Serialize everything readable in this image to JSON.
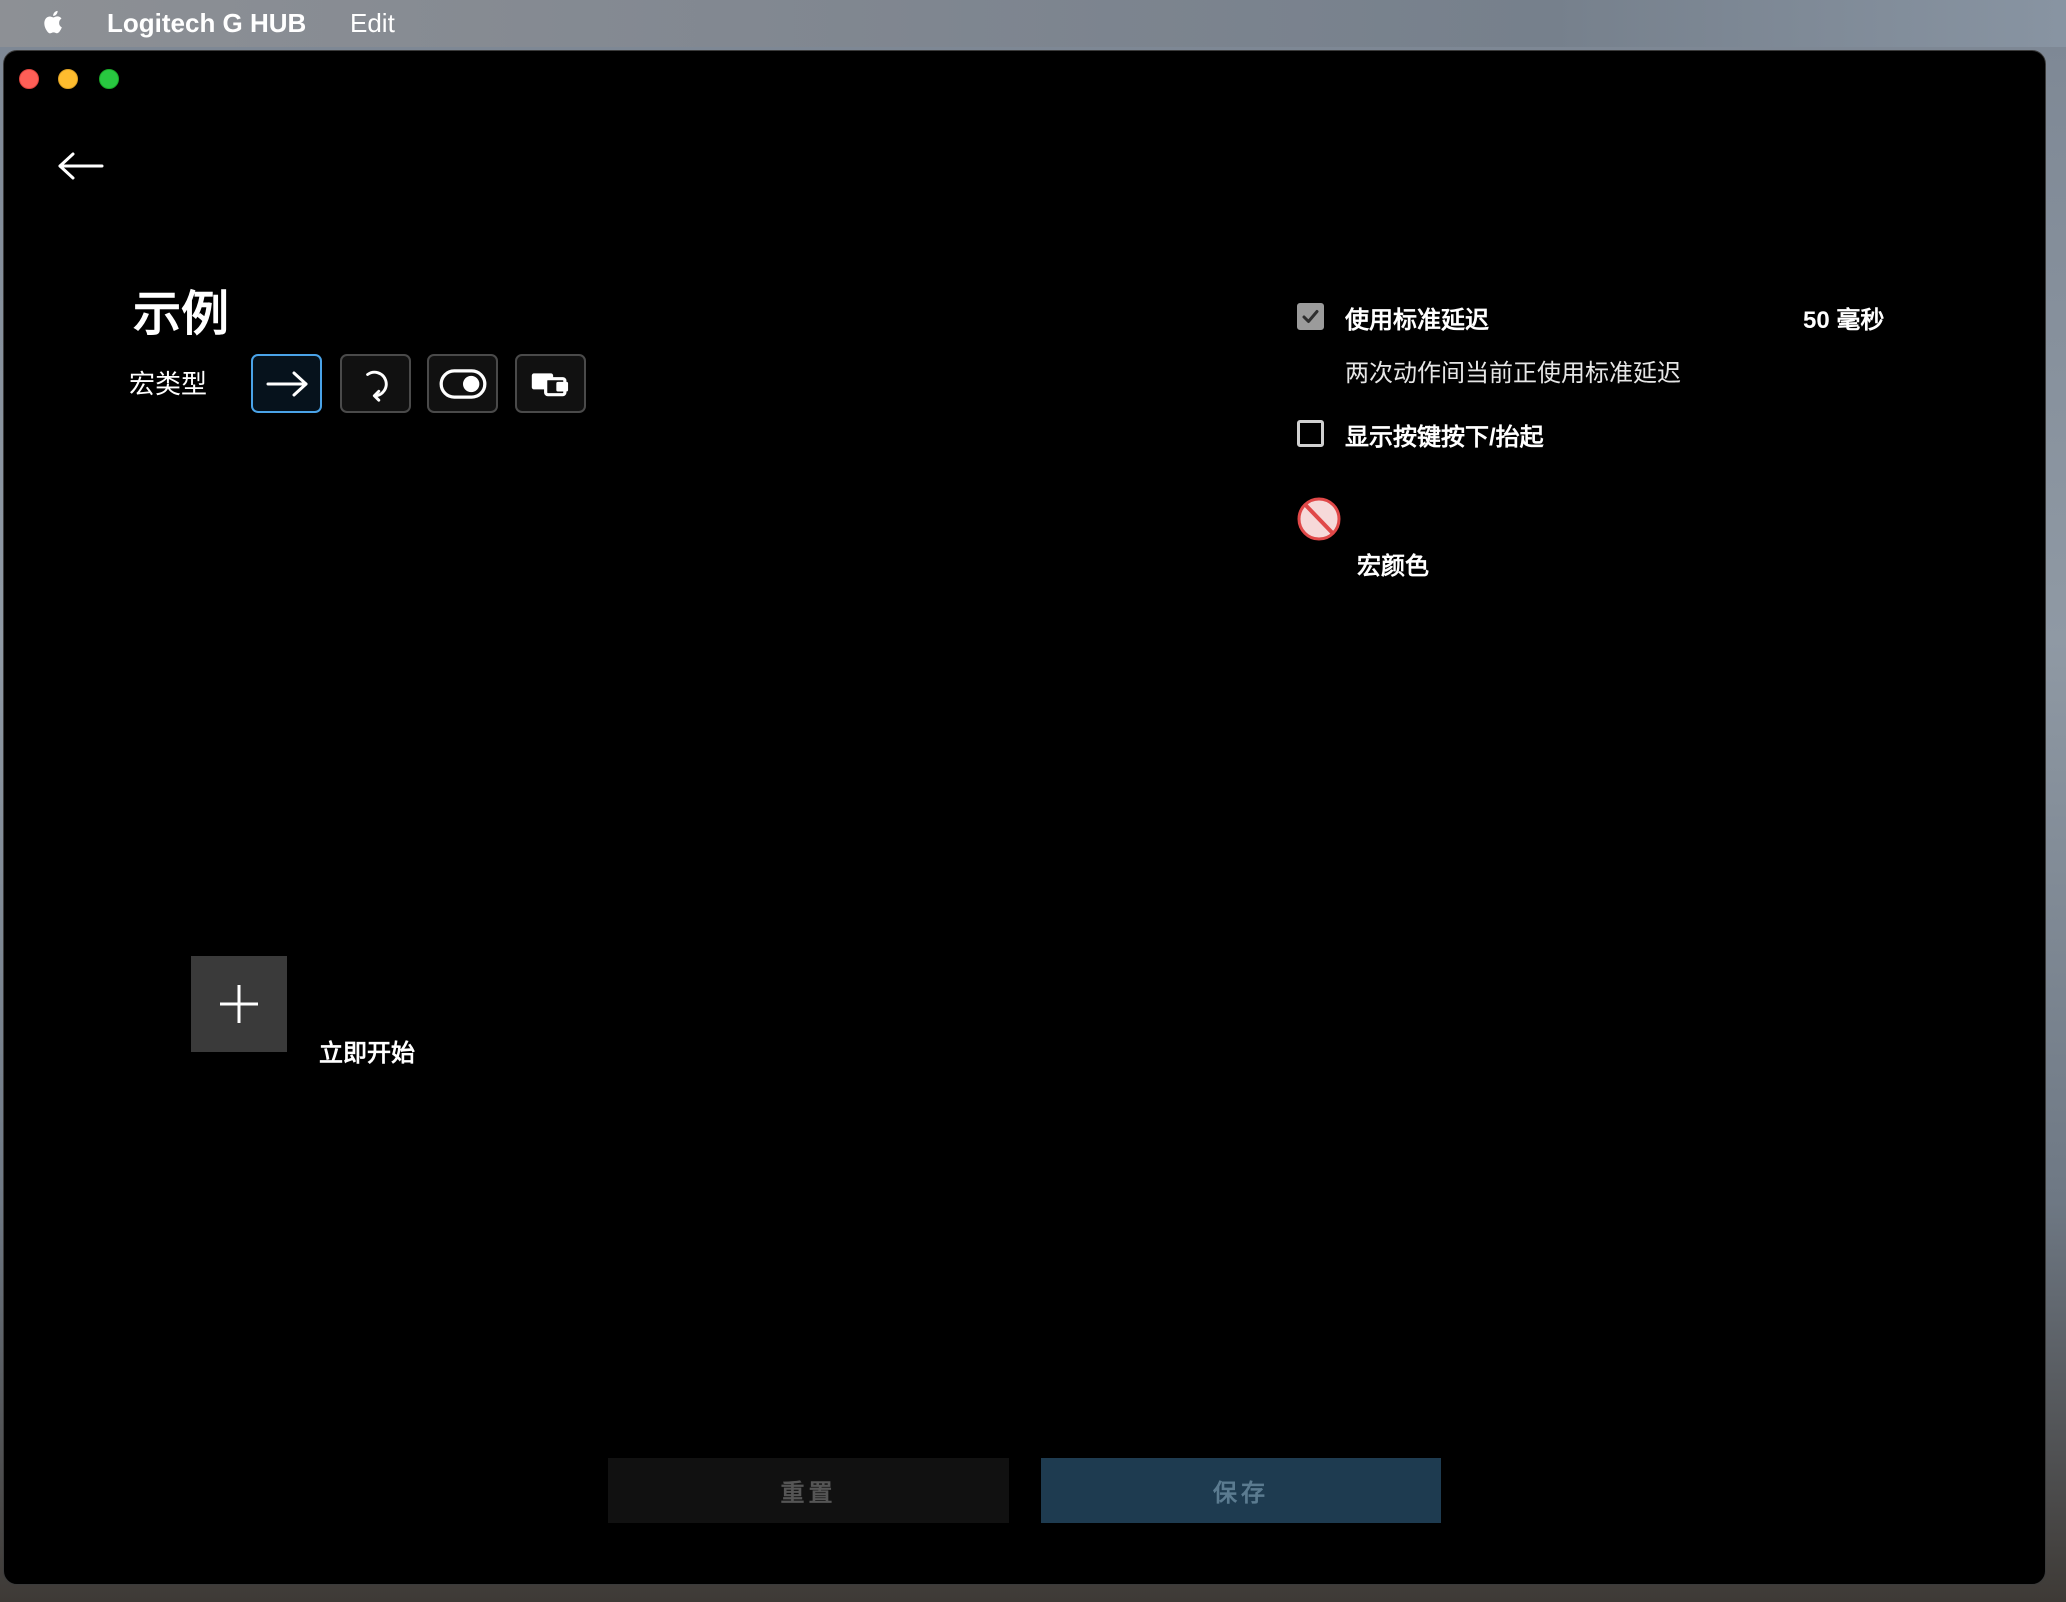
{
  "menubar": {
    "app_name": "Logitech G HUB",
    "items": [
      "Edit"
    ]
  },
  "page": {
    "title": "示例",
    "macro_type_label": "宏类型",
    "macro_types": [
      {
        "icon": "arrow-right-icon",
        "selected": true
      },
      {
        "icon": "loop-icon",
        "selected": false
      },
      {
        "icon": "toggle-icon",
        "selected": false
      },
      {
        "icon": "sequence-icon",
        "selected": false
      }
    ],
    "start_label": "立即开始"
  },
  "settings": {
    "standard_delay": {
      "label": "使用标准延迟",
      "checked": true,
      "value": "50 毫秒",
      "description": "两次动作间当前正使用标准延迟"
    },
    "show_key_press": {
      "label": "显示按键按下/抬起",
      "checked": false
    },
    "macro_color": {
      "label": "宏颜色",
      "icon": "no-color-icon"
    }
  },
  "footer": {
    "reset_label": "重置",
    "save_label": "保存"
  },
  "colors": {
    "background": "#000000",
    "accent": "#4aa3e8",
    "save_button": "#1e3b50",
    "reset_button": "#111111",
    "no_color_red": "#e04848"
  }
}
